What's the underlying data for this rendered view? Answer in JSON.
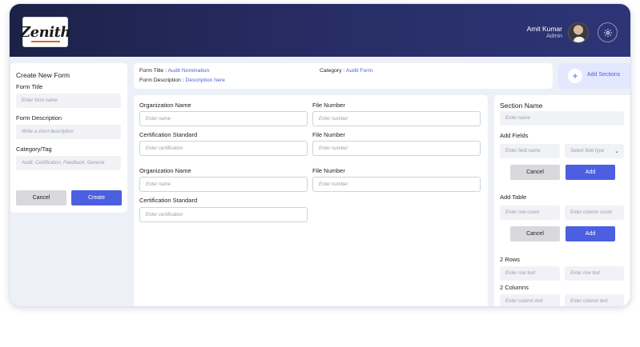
{
  "header": {
    "logo_text": "Zenith",
    "user_name": "Amit Kumar",
    "user_role": "Admin",
    "settings_icon": "gear-icon",
    "colors": {
      "topbar_start": "#1c2147",
      "topbar_end": "#2e3577",
      "accent": "#4c5fe0",
      "logo_accent": "#e0641e"
    }
  },
  "create_form": {
    "title": "Create New Form",
    "form_title_label": "Form Title",
    "form_title_placeholder": "Enter form name",
    "description_label": "Form Description",
    "description_placeholder": "Write a short description",
    "category_label": "Category/Tag",
    "category_placeholder": "Audit, Certification, Feedback, General",
    "cancel_label": "Cancel",
    "create_label": "Create"
  },
  "form_info": {
    "title_label": "Form Title :",
    "title_value": "Audit Nomination",
    "description_label": "Form Description :",
    "description_value": "Description here",
    "category_label": "Category :",
    "category_value": "Audit Form"
  },
  "add_sections": {
    "label": "Add Sections",
    "icon": "plus-icon"
  },
  "form_fields": {
    "org_name_label_1": "Organization Name",
    "org_name_placeholder_1": "Enter name",
    "file_number_label_1": "File Number",
    "file_number_placeholder_1": "Enter number",
    "cert_label_1": "Certification Standard",
    "cert_placeholder_1": "Enter certification",
    "file_number_label_2": "File Number",
    "file_number_placeholder_2": "Enter number",
    "org_name_label_2": "Organization Name",
    "org_name_placeholder_2": "Enter name",
    "file_number_label_3": "File Number",
    "file_number_placeholder_3": "Enter number",
    "cert_label_2": "Certification Standard",
    "cert_placeholder_2": "Enter certification"
  },
  "section_panel": {
    "section_name_label": "Section Name",
    "section_name_placeholder": "Enter name",
    "add_fields_label": "Add Fields",
    "field_name_placeholder": "Enter field name",
    "field_type_placeholder": "Select field type",
    "cancel_label_1": "Cancel",
    "add_label_1": "Add",
    "add_table_label": "Add Table",
    "row_count_placeholder": "Enter row count",
    "column_count_placeholder": "Enter column count",
    "cancel_label_2": "Cancel",
    "add_label_2": "Add",
    "rows_label": "2 Rows",
    "row_text_placeholder_1": "Enter row text",
    "row_text_placeholder_2": "Enter row text",
    "columns_label": "2 Columns",
    "column_text_placeholder_1": "Enter column text",
    "column_text_placeholder_2": "Enter column text"
  }
}
